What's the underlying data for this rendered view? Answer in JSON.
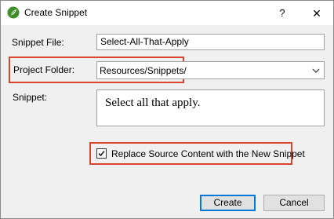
{
  "window": {
    "title": "Create Snippet",
    "help_label": "?",
    "close_label": "✕"
  },
  "form": {
    "snippet_file_label": "Snippet File:",
    "snippet_file_value": "Select-All-That-Apply",
    "project_folder_label": "Project Folder:",
    "project_folder_value": "Resources/Snippets/",
    "snippet_label": "Snippet:",
    "snippet_value": "Select all that apply.",
    "replace_label": "Replace Source Content with the New Snippet",
    "replace_checked": true
  },
  "buttons": {
    "create": "Create",
    "cancel": "Cancel"
  },
  "colors": {
    "highlight": "#d9462f",
    "app_icon": "#3f8f2b",
    "default_button_border": "#0078d7"
  }
}
